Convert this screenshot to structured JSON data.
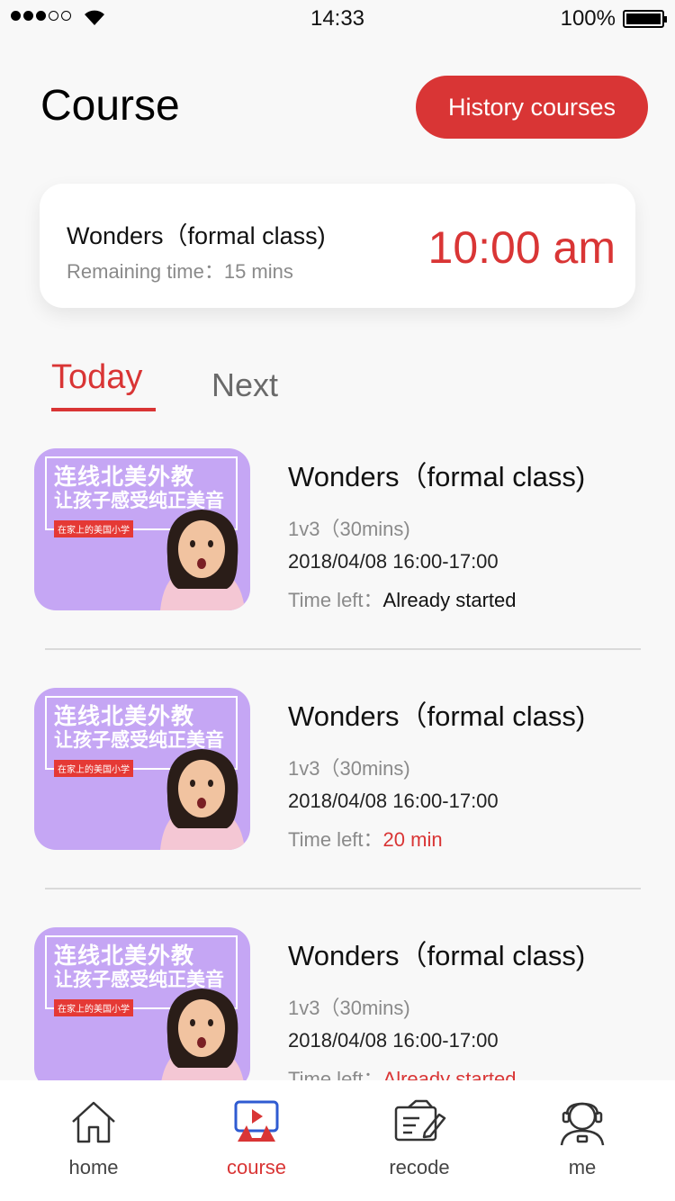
{
  "status_bar": {
    "time": "14:33",
    "battery": "100%",
    "signal_bars": 3
  },
  "header": {
    "title": "Course",
    "history_button": "History courses"
  },
  "next_class": {
    "title": "Wonders（formal class)",
    "remaining": "Remaining time：15 mins",
    "time": "10:00 am"
  },
  "tabs": [
    {
      "label": "Today",
      "active": true
    },
    {
      "label": "Next",
      "active": false
    }
  ],
  "courses": [
    {
      "thumb": {
        "line1": "连线北美外教",
        "line2": "让孩子感受纯正美音",
        "tag": "在家上的美国小学"
      },
      "title": "Wonders（formal class)",
      "meta": "1v3（30mins)",
      "date": "2018/04/08 16:00-17:00",
      "time_left_label": "Time left：",
      "time_left_value": "Already started",
      "value_color": "#111111"
    },
    {
      "thumb": {
        "line1": "连线北美外教",
        "line2": "让孩子感受纯正美音",
        "tag": "在家上的美国小学"
      },
      "title": "Wonders（formal class)",
      "meta": "1v3（30mins)",
      "date": "2018/04/08 16:00-17:00",
      "time_left_label": "Time left：",
      "time_left_value": "20 min",
      "value_color": "#d93535"
    },
    {
      "thumb": {
        "line1": "连线北美外教",
        "line2": "让孩子感受纯正美音",
        "tag": "在家上的美国小学"
      },
      "title": "Wonders（formal class)",
      "meta": "1v3（30mins)",
      "date": "2018/04/08 16:00-17:00",
      "time_left_label": "Time left：",
      "time_left_value": "Already started",
      "value_color": "#d93535"
    }
  ],
  "tab_bar": [
    {
      "label": "home",
      "icon": "home-icon",
      "active": false
    },
    {
      "label": "course",
      "icon": "course-icon",
      "active": true
    },
    {
      "label": "recode",
      "icon": "recode-icon",
      "active": false
    },
    {
      "label": "me",
      "icon": "me-icon",
      "active": false
    }
  ],
  "colors": {
    "accent": "#d93535",
    "thumb_bg": "#c5a6f4"
  }
}
